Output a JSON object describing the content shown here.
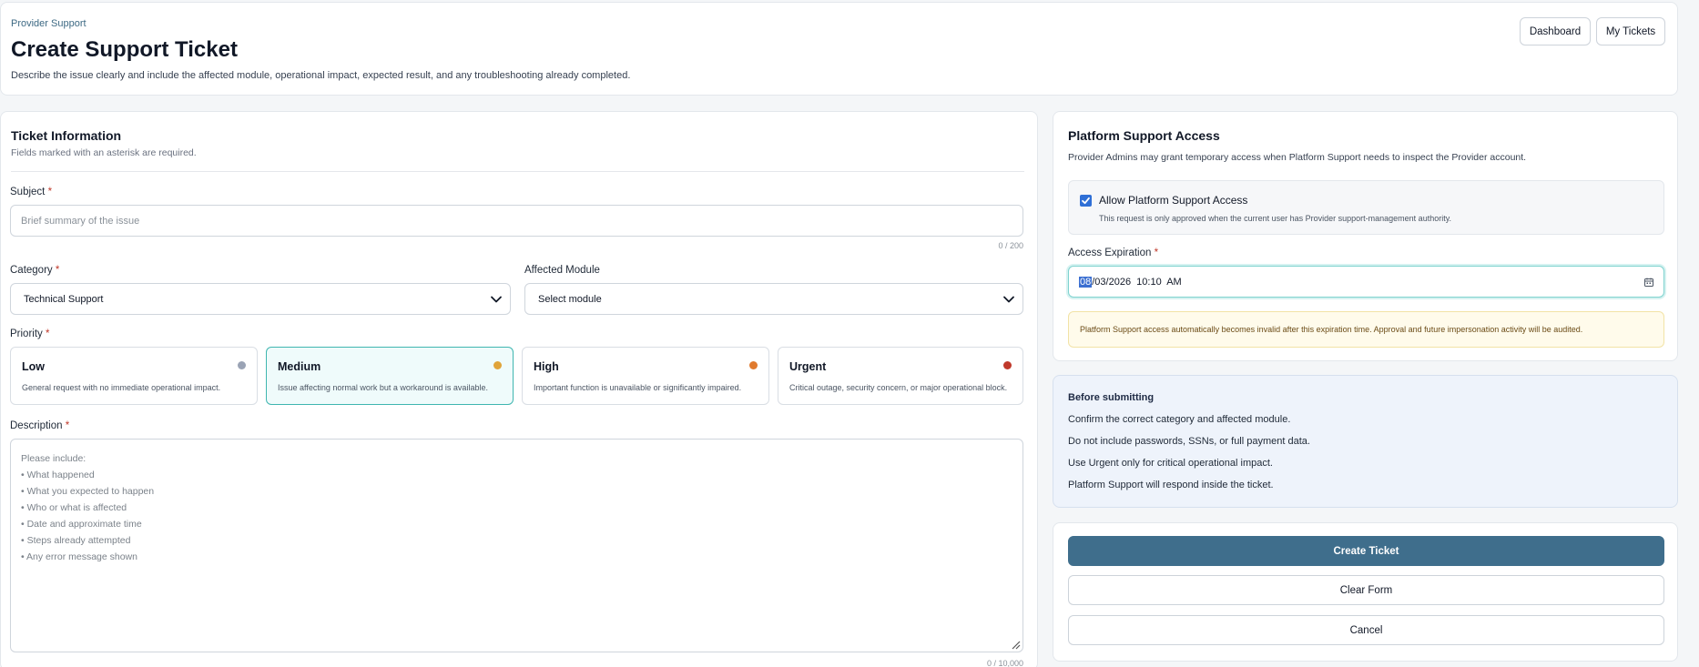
{
  "header": {
    "breadcrumb": "Provider Support",
    "title": "Create Support Ticket",
    "description": "Describe the issue clearly and include the affected module, operational impact, expected result, and any troubleshooting already completed.",
    "buttons": {
      "dashboard": "Dashboard",
      "my_tickets": "My Tickets"
    }
  },
  "ticket": {
    "title": "Ticket Information",
    "subtitle": "Fields marked with an asterisk are required.",
    "subject": {
      "label": "Subject",
      "placeholder": "Brief summary of the issue",
      "value": "",
      "counter": "0 / 200"
    },
    "category": {
      "label": "Category",
      "value": "Technical Support"
    },
    "module": {
      "label": "Affected Module",
      "value": "Select module"
    },
    "priority": {
      "label": "Priority",
      "selected": "Medium",
      "options": [
        {
          "name": "Low",
          "description": "General request with no immediate operational impact.",
          "color": "#9aa3b5"
        },
        {
          "name": "Medium",
          "description": "Issue affecting normal work but a workaround is available.",
          "color": "#e0a43a"
        },
        {
          "name": "High",
          "description": "Important function is unavailable or significantly impaired.",
          "color": "#e07a2e"
        },
        {
          "name": "Urgent",
          "description": "Critical outage, security concern, or major operational block.",
          "color": "#c0392b"
        }
      ]
    },
    "description": {
      "label": "Description",
      "placeholder_lines": [
        "Please include:",
        "• What happened",
        "• What you expected to happen",
        "• Who or what is affected",
        "• Date and approximate time",
        "• Steps already attempted",
        "• Any error message shown"
      ],
      "counter": "0 / 10,000"
    }
  },
  "access": {
    "title": "Platform Support Access",
    "description": "Provider Admins may grant temporary access when Platform Support needs to inspect the Provider account.",
    "checkbox": {
      "label": "Allow Platform Support Access",
      "checked": true,
      "note": "This request is only approved when the current user has Provider support-management authority."
    },
    "expiration": {
      "label": "Access Expiration",
      "highlighted_part": "08",
      "rest_value": "/03/2026  10:10  AM"
    },
    "warning": "Platform Support access automatically becomes invalid after this expiration time. Approval and future impersonation activity will be audited."
  },
  "tips": {
    "title": "Before submitting",
    "items": [
      "Confirm the correct category and affected module.",
      "Do not include passwords, SSNs, or full payment data.",
      "Use Urgent only for critical operational impact.",
      "Platform Support will respond inside the ticket."
    ]
  },
  "actions": {
    "create": "Create Ticket",
    "clear": "Clear Form",
    "cancel": "Cancel"
  },
  "colors": {
    "accent": "#3f6e8c",
    "selected_border": "#3fb6b0",
    "required": "#c0392b"
  }
}
